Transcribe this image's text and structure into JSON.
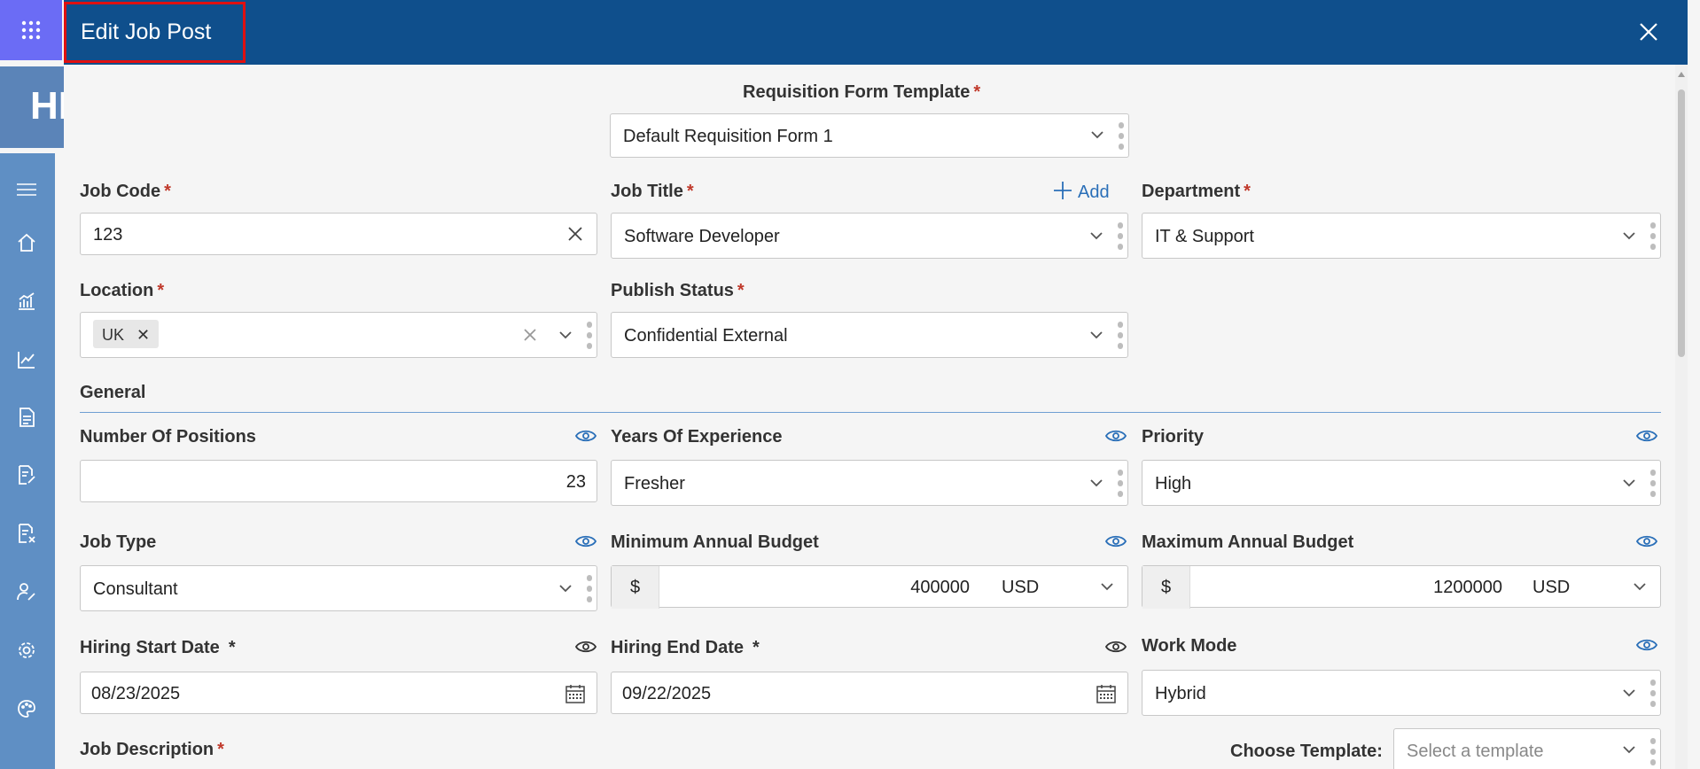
{
  "app": {
    "header_peek": "HI"
  },
  "panel": {
    "title": "Edit Job Post"
  },
  "requisition": {
    "label": "Requisition Form Template",
    "value": "Default Requisition Form 1"
  },
  "job_code": {
    "label": "Job Code",
    "value": "123"
  },
  "job_title": {
    "label": "Job Title",
    "value": "Software Developer",
    "add_label": "Add"
  },
  "department": {
    "label": "Department",
    "value": "IT & Support"
  },
  "location": {
    "label": "Location",
    "tag": "UK"
  },
  "publish_status": {
    "label": "Publish Status",
    "value": "Confidential External"
  },
  "general": {
    "title": "General",
    "number_of_positions": {
      "label": "Number Of Positions",
      "value": "23"
    },
    "years_of_experience": {
      "label": "Years Of Experience",
      "value": "Fresher"
    },
    "priority": {
      "label": "Priority",
      "value": "High"
    },
    "job_type": {
      "label": "Job Type",
      "value": "Consultant"
    },
    "min_budget": {
      "label": "Minimum Annual Budget",
      "prefix": "$",
      "value": "400000",
      "currency": "USD"
    },
    "max_budget": {
      "label": "Maximum Annual Budget",
      "prefix": "$",
      "value": "1200000",
      "currency": "USD"
    },
    "hiring_start": {
      "label": "Hiring Start Date",
      "value": "08/23/2025"
    },
    "hiring_end": {
      "label": "Hiring End Date",
      "value": "09/22/2025"
    },
    "work_mode": {
      "label": "Work Mode",
      "value": "Hybrid"
    },
    "job_description": {
      "label": "Job Description"
    },
    "choose_template": {
      "label": "Choose Template:",
      "placeholder": "Select a template"
    }
  },
  "required_marker": "*",
  "colors": {
    "header": "#0f4f8c",
    "sidebar": "#5f8fc4",
    "app_grid": "#6b6cf5",
    "accent": "#2a6fb8",
    "required": "#c0392b",
    "title_outline": "#e01010"
  }
}
